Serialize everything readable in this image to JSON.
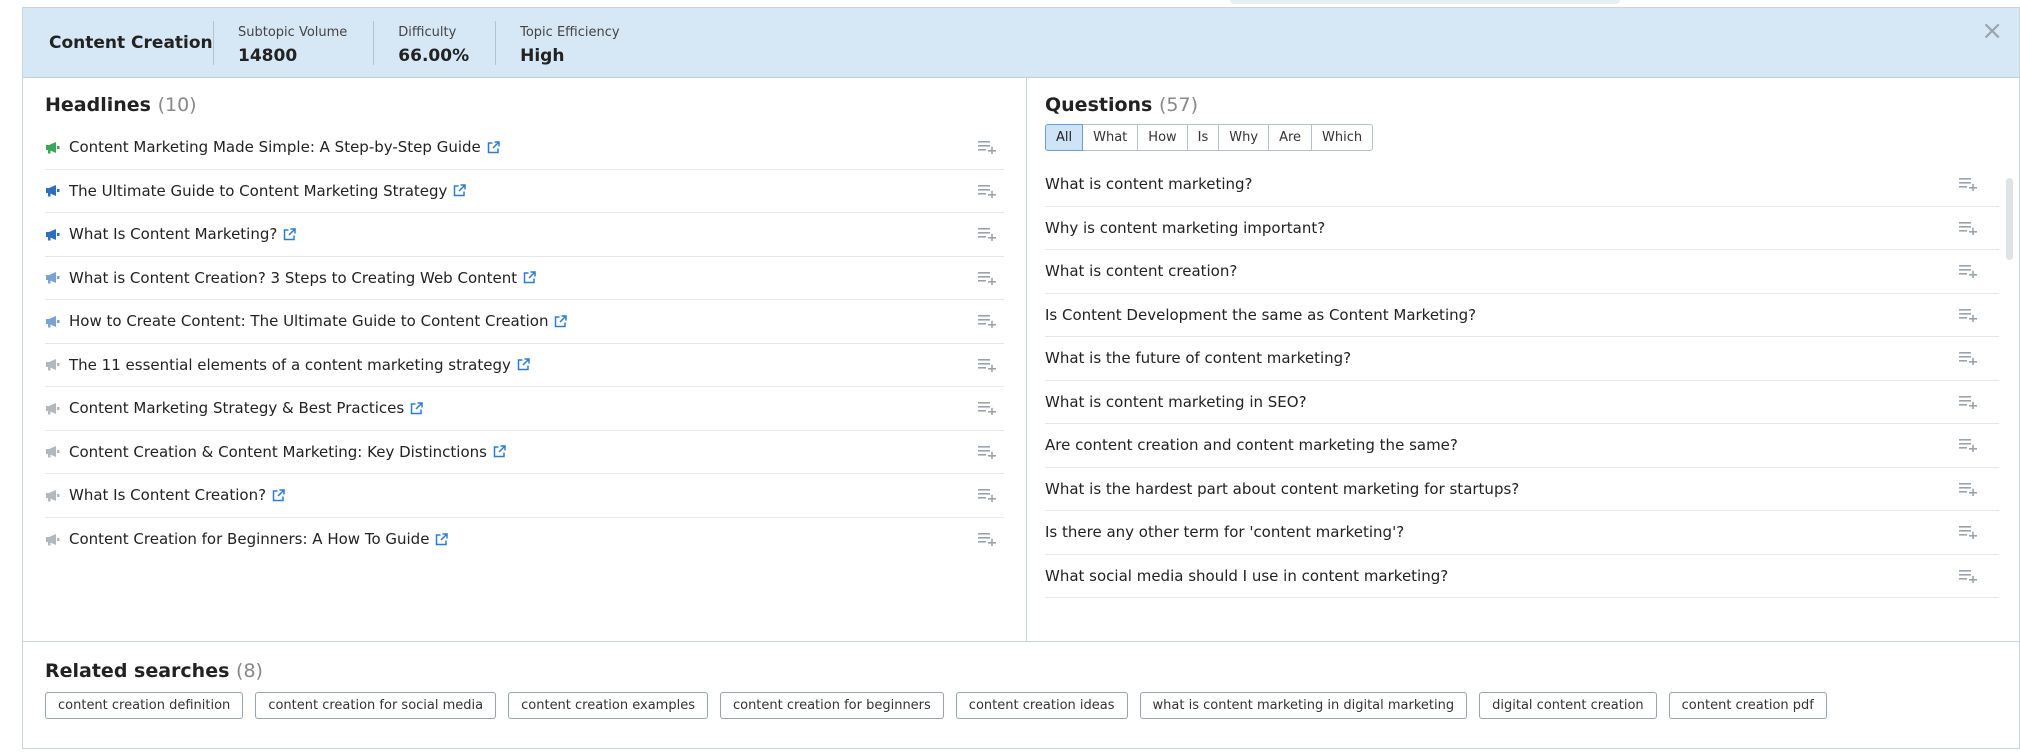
{
  "header": {
    "title": "Content Creation",
    "stats": [
      {
        "label": "Subtopic Volume",
        "value": "14800"
      },
      {
        "label": "Difficulty",
        "value": "66.00%"
      },
      {
        "label": "Topic Efficiency",
        "value": "High"
      }
    ],
    "close_label": "×"
  },
  "headlines": {
    "title": "Headlines",
    "count": "(10)",
    "items": [
      {
        "text": "Content Marketing Made Simple: A Step-by-Step Guide",
        "icon_color": "#3aa657"
      },
      {
        "text": "The Ultimate Guide to Content Marketing Strategy",
        "icon_color": "#2d6fbf"
      },
      {
        "text": "What Is Content Marketing?",
        "icon_color": "#2d6fbf"
      },
      {
        "text": "What is Content Creation? 3 Steps to Creating Web Content",
        "icon_color": "#7aa3d2"
      },
      {
        "text": "How to Create Content: The Ultimate Guide to Content Creation",
        "icon_color": "#7aa3d2"
      },
      {
        "text": "The 11 essential elements of a content marketing strategy",
        "icon_color": "#b3b8bd"
      },
      {
        "text": "Content Marketing Strategy & Best Practices",
        "icon_color": "#b3b8bd"
      },
      {
        "text": "Content Creation & Content Marketing: Key Distinctions",
        "icon_color": "#b3b8bd"
      },
      {
        "text": "What Is Content Creation?",
        "icon_color": "#b3b8bd"
      },
      {
        "text": "Content Creation for Beginners: A How To Guide",
        "icon_color": "#b3b8bd"
      }
    ]
  },
  "questions": {
    "title": "Questions",
    "count": "(57)",
    "tabs": [
      "All",
      "What",
      "How",
      "Is",
      "Why",
      "Are",
      "Which"
    ],
    "active_tab": "All",
    "items": [
      "What is content marketing?",
      "Why is content marketing important?",
      "What is content creation?",
      "Is Content Development the same as Content Marketing?",
      "What is the future of content marketing?",
      "What is content marketing in SEO?",
      "Are content creation and content marketing the same?",
      "What is the hardest part about content marketing for startups?",
      "Is there any other term for 'content marketing'?",
      "What social media should I use in content marketing?"
    ]
  },
  "related": {
    "title": "Related searches",
    "count": "(8)",
    "chips": [
      "content creation definition",
      "content creation for social media",
      "content creation examples",
      "content creation for beginners",
      "content creation ideas",
      "what is content marketing in digital marketing",
      "digital content creation",
      "content creation pdf"
    ]
  },
  "colors": {
    "link_icon": "#2b7bd3",
    "add_icon": "#9aa3ab"
  }
}
